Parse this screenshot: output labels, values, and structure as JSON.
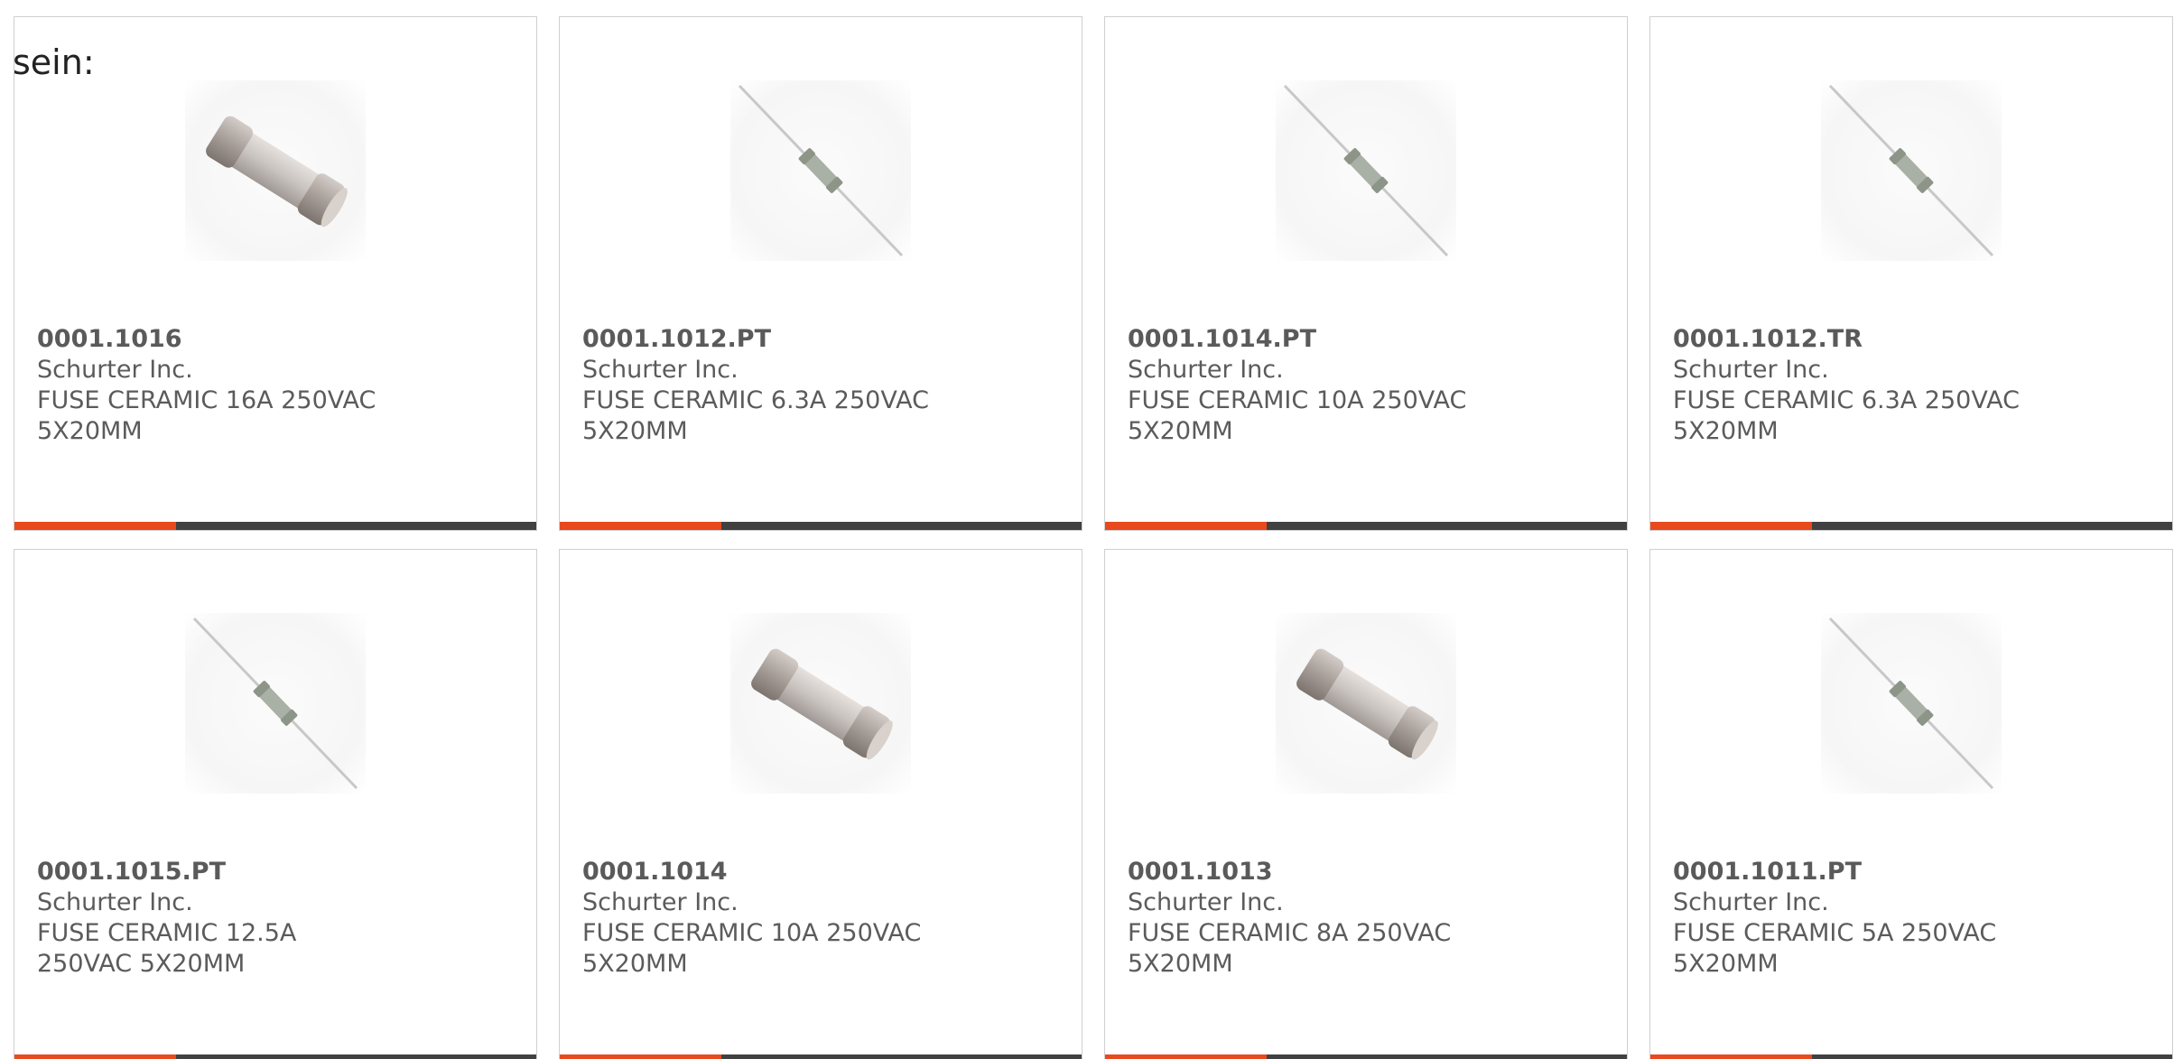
{
  "heading_fragment": "sein:",
  "colors": {
    "accent": "#e84a1d",
    "track": "#414141",
    "border": "#cfcfcf",
    "text": "#5b5b5b"
  },
  "products": [
    {
      "part": "0001.1016",
      "manufacturer": "Schurter Inc.",
      "description": "FUSE CERAMIC 16A 250VAC 5X20MM",
      "image": "cartridge-fuse-image",
      "accent_fraction": 0.31
    },
    {
      "part": "0001.1012.PT",
      "manufacturer": "Schurter Inc.",
      "description": "FUSE CERAMIC 6.3A 250VAC 5X20MM",
      "image": "axial-lead-fuse-image",
      "accent_fraction": 0.31
    },
    {
      "part": "0001.1014.PT",
      "manufacturer": "Schurter Inc.",
      "description": "FUSE CERAMIC 10A 250VAC 5X20MM",
      "image": "axial-lead-fuse-image",
      "accent_fraction": 0.31
    },
    {
      "part": "0001.1012.TR",
      "manufacturer": "Schurter Inc.",
      "description": "FUSE CERAMIC 6.3A 250VAC 5X20MM",
      "image": "axial-lead-fuse-image",
      "accent_fraction": 0.31
    },
    {
      "part": "0001.1015.PT",
      "manufacturer": "Schurter Inc.",
      "description": "FUSE CERAMIC 12.5A 250VAC 5X20MM",
      "image": "axial-lead-fuse-image",
      "accent_fraction": 0.31
    },
    {
      "part": "0001.1014",
      "manufacturer": "Schurter Inc.",
      "description": "FUSE CERAMIC 10A 250VAC 5X20MM",
      "image": "cartridge-fuse-image",
      "accent_fraction": 0.31
    },
    {
      "part": "0001.1013",
      "manufacturer": "Schurter Inc.",
      "description": "FUSE CERAMIC 8A 250VAC 5X20MM",
      "image": "cartridge-fuse-image",
      "accent_fraction": 0.31
    },
    {
      "part": "0001.1011.PT",
      "manufacturer": "Schurter Inc.",
      "description": "FUSE CERAMIC 5A 250VAC 5X20MM",
      "image": "axial-lead-fuse-image",
      "accent_fraction": 0.31
    }
  ]
}
